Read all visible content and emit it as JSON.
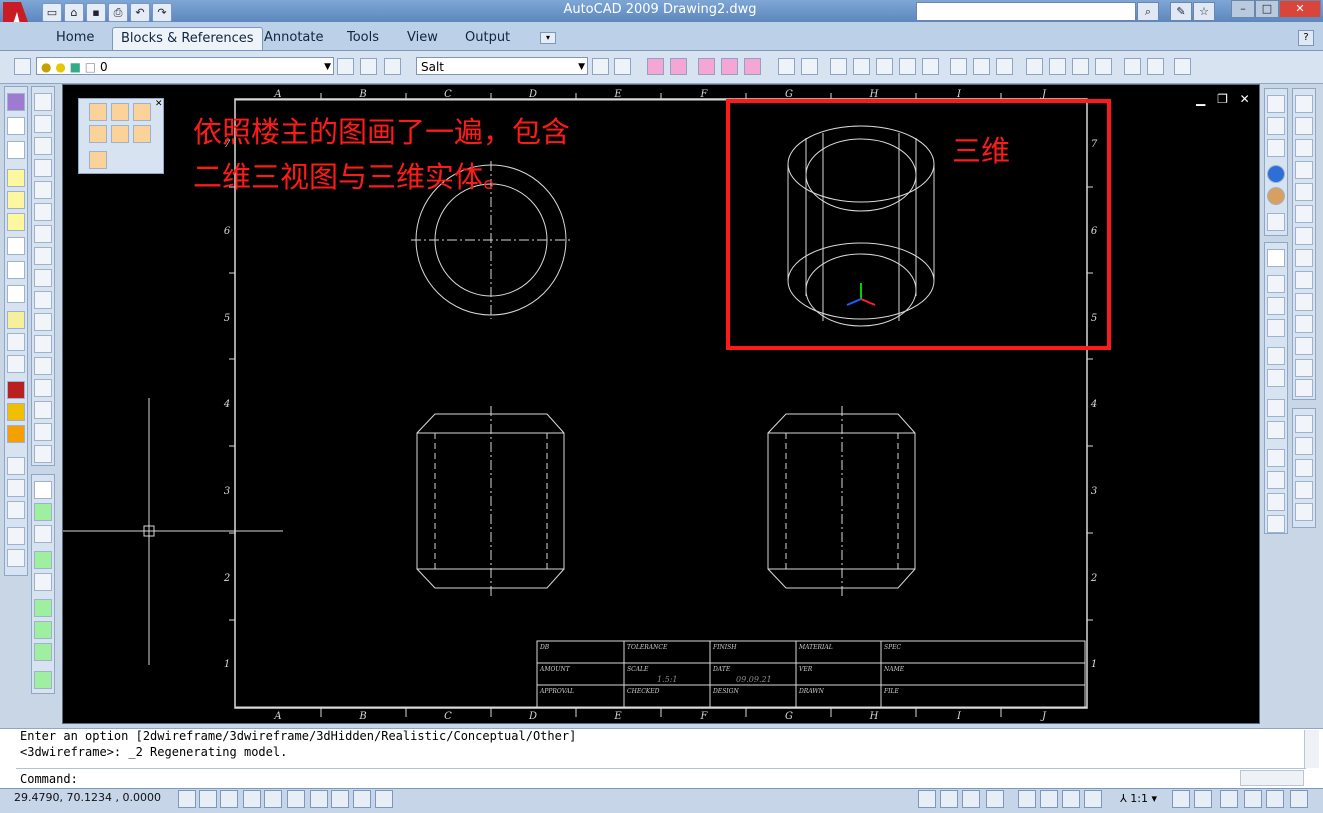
{
  "window": {
    "title": "AutoCAD 2009 Drawing2.dwg",
    "controls": [
      "–",
      "□",
      "✕"
    ]
  },
  "quick_access": [
    "new-icon",
    "open-icon",
    "save-icon",
    "print-icon",
    "undo-icon",
    "redo-icon"
  ],
  "ribbon_tabs": [
    {
      "label": "Home",
      "active": false
    },
    {
      "label": "Blocks & References",
      "active": true
    },
    {
      "label": "Annotate",
      "active": false
    },
    {
      "label": "Tools",
      "active": false
    },
    {
      "label": "View",
      "active": false
    },
    {
      "label": "Output",
      "active": false
    }
  ],
  "help_label": "?",
  "layer_combo": {
    "value": "0"
  },
  "style_combo": {
    "value": "Salt"
  },
  "annotation": {
    "line1": "依照楼主的图画了一遍，包含",
    "line2": "二维三视图与三维实体。",
    "label_3d": "三维"
  },
  "border_columns": [
    "A",
    "B",
    "C",
    "D",
    "E",
    "F",
    "G",
    "H",
    "I",
    "J"
  ],
  "border_rows": [
    "7",
    "6",
    "5",
    "4",
    "3",
    "2",
    "1"
  ],
  "title_block": {
    "row1": [
      "DB",
      "TOLERANCE",
      "FINISH",
      "MATERIAL",
      "SPEC"
    ],
    "row2": [
      "AMOUNT",
      "SCALE",
      "DATE",
      "VER",
      "NAME"
    ],
    "row2_values": [
      "1.5:1",
      "09.09.21"
    ],
    "row3": [
      "APPROVAL",
      "CHECKED",
      "DESIGN",
      "DRAWN",
      "FILE"
    ]
  },
  "command": {
    "line1": "Enter an option [2dwireframe/3dwireframe/3dHidden/Realistic/Conceptual/Other]",
    "line2": "<3dwireframe>: _2 Regenerating model.",
    "prompt": "Command:"
  },
  "status": {
    "coordinates": "29.4790, 70.1234 , 0.0000",
    "scale": "1:1"
  },
  "colors": {
    "annotation_red": "#ff1a1a",
    "canvas_bg": "#000000",
    "ribbon_bg": "#bcd0e8"
  }
}
